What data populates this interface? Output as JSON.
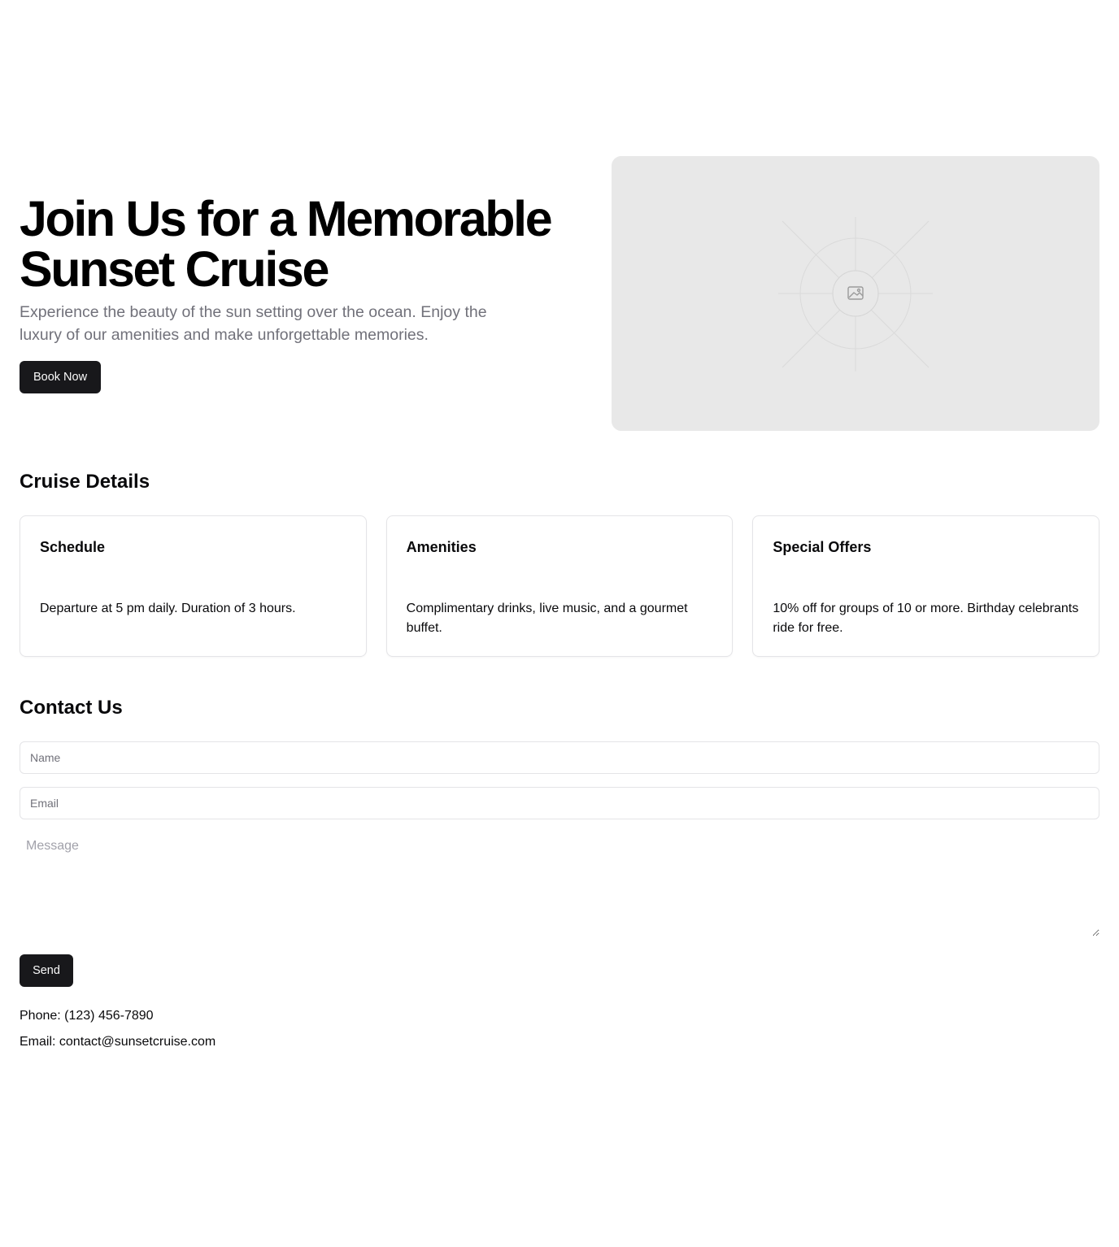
{
  "hero": {
    "title_line1": "Join Us for a Memorable",
    "title_line2": "Sunset Cruise",
    "subtitle": "Experience the beauty of the sun setting over the ocean. Enjoy the luxury of our amenities and make unforgettable memories.",
    "cta_label": "Book Now",
    "image_icon": "image-placeholder-icon"
  },
  "details": {
    "title": "Cruise Details",
    "cards": [
      {
        "title": "Schedule",
        "body": "Departure at 5 pm daily. Duration of 3 hours."
      },
      {
        "title": "Amenities",
        "body": "Complimentary drinks, live music, and a gourmet buffet."
      },
      {
        "title": "Special Offers",
        "body": "10% off for groups of 10 or more. Birthday celebrants ride for free."
      }
    ]
  },
  "contact": {
    "title": "Contact Us",
    "name_placeholder": "Name",
    "email_placeholder": "Email",
    "message_placeholder": "Message",
    "send_label": "Send",
    "phone": "Phone: (123) 456-7890",
    "email": "Email: contact@sunsetcruise.com"
  },
  "colors": {
    "primary": "#18181b",
    "muted_text": "#71717a",
    "border": "#e4e4e7",
    "placeholder_bg": "#e8e8e8"
  }
}
